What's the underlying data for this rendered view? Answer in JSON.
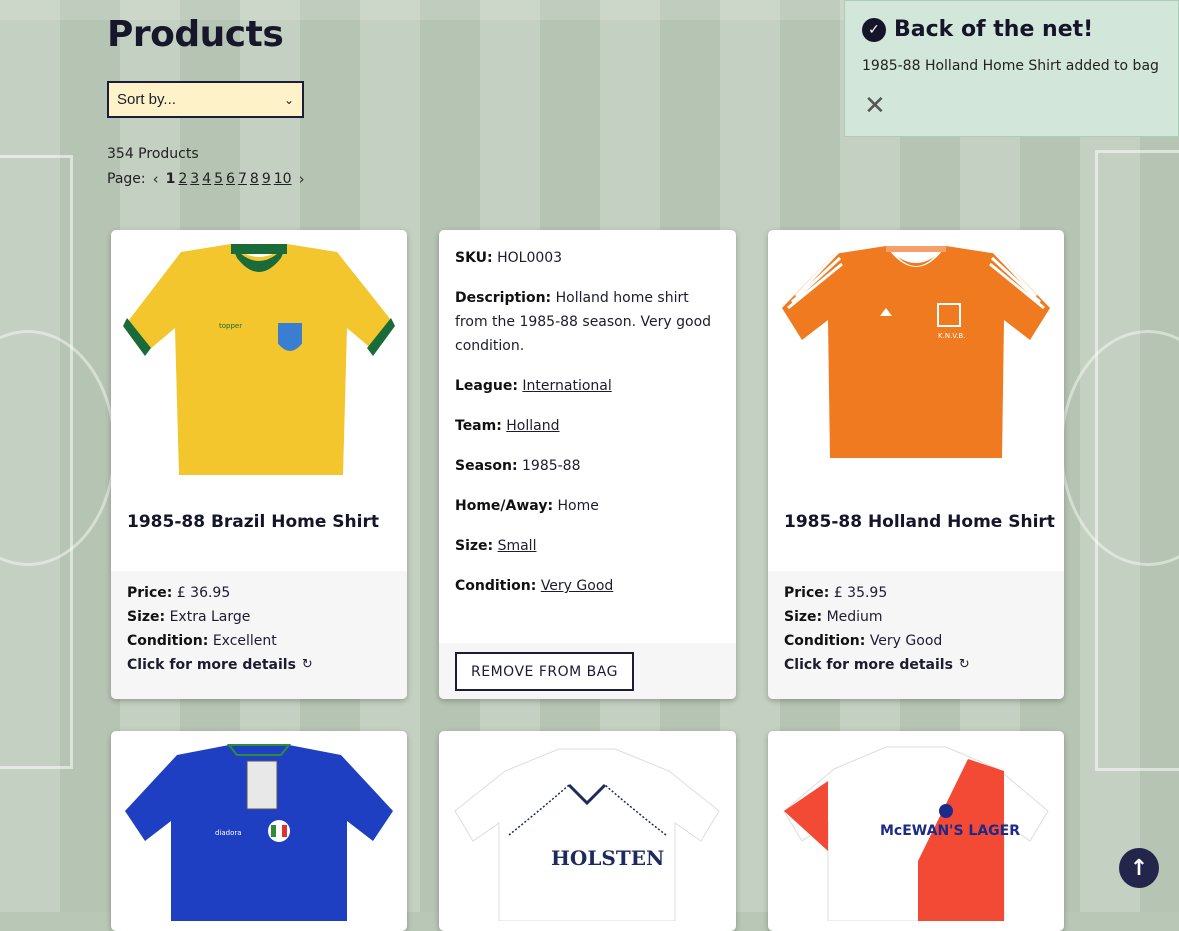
{
  "page": {
    "title": "Products"
  },
  "sort": {
    "selected": "Sort by..."
  },
  "results": {
    "count_text": "354 Products"
  },
  "pagination": {
    "label": "Page:",
    "prev": "‹",
    "next": "›",
    "pages": [
      "1",
      "2",
      "3",
      "4",
      "5",
      "6",
      "7",
      "8",
      "9",
      "10"
    ],
    "current": "1"
  },
  "products": [
    {
      "name": "1985-88 Brazil Home Shirt",
      "price_label": "Price:",
      "price": "£ 36.95",
      "size_label": "Size:",
      "size": "Extra Large",
      "condition_label": "Condition:",
      "condition": "Excellent",
      "more": "Click for more details",
      "color": "#f2c62c"
    },
    {
      "name": "1985-88 Holland Home Shirt",
      "price_label": "Price:",
      "price": "£ 35.95",
      "size_label": "Size:",
      "size": "Medium",
      "condition_label": "Condition:",
      "condition": "Very Good",
      "more": "Click for more details",
      "color": "#f07a1f"
    }
  ],
  "detail": {
    "sku_label": "SKU:",
    "sku": "HOL0003",
    "desc_label": "Description:",
    "desc": "Holland home shirt from the 1985-88 season. Very good condition.",
    "league_label": "League:",
    "league": "International",
    "team_label": "Team:",
    "team": "Holland",
    "season_label": "Season:",
    "season": "1985-88",
    "homeaway_label": "Home/Away:",
    "homeaway": "Home",
    "size_label": "Size:",
    "size": "Small",
    "condition_label": "Condition:",
    "condition": "Very Good",
    "remove_button": "REMOVE FROM BAG"
  },
  "row2": [
    {
      "color": "#1f3fc2"
    },
    {
      "color": "#ffffff",
      "sponsor": "HOLSTEN"
    },
    {
      "color": "#f24a35",
      "sponsor": "McEWAN'S LAGER"
    }
  ],
  "toast": {
    "title": "Back of the net!",
    "message": "1985-88 Holland Home Shirt added to bag",
    "close": "✕"
  },
  "back_to_top": "↑"
}
